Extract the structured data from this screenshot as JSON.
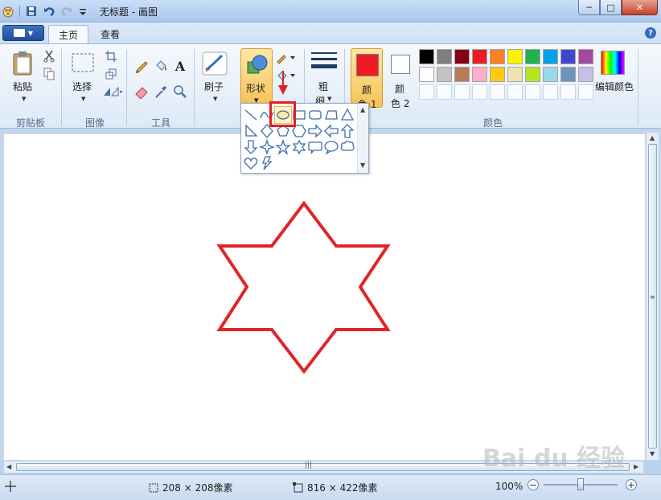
{
  "window": {
    "title": "无标题 - 画图",
    "controls": {
      "minimize": "─",
      "maximize": "□",
      "close": "✕"
    }
  },
  "tabs": {
    "home": "主页",
    "view": "查看",
    "help": "?"
  },
  "ribbon": {
    "clipboard": {
      "paste_label": "粘贴",
      "group": "剪贴板"
    },
    "image": {
      "select_label": "选择",
      "group": "图像"
    },
    "tools": {
      "text_glyph": "A",
      "group": "工具"
    },
    "brushes": {
      "label": "刷子"
    },
    "shapes": {
      "label": "形状"
    },
    "size": {
      "label_line1": "粗",
      "label_line2": "细"
    },
    "colors": {
      "color1_line1": "颜",
      "color1_line2": "色 1",
      "color2_line1": "颜",
      "color2_line2": "色 2",
      "edit_label": "编辑颜色",
      "group": "颜色",
      "color1_value": "#ed1c24",
      "color2_value": "#ffffff",
      "palette": [
        "#000000",
        "#7f7f7f",
        "#880015",
        "#ed1c24",
        "#ff7f27",
        "#fff200",
        "#22b14c",
        "#00a2e8",
        "#3f48cc",
        "#a349a4",
        "#ffffff",
        "#c3c3c3",
        "#b97a57",
        "#ffaec9",
        "#ffc90e",
        "#efe4b0",
        "#b5e61d",
        "#99d9ea",
        "#7092be",
        "#c8bfe7",
        "",
        "",
        "",
        "",
        "",
        "",
        "",
        "",
        "",
        ""
      ]
    }
  },
  "shapes_gallery": {
    "highlighted": "oval",
    "shapes": [
      "line",
      "curve",
      "oval",
      "rectangle",
      "rounded-rectangle",
      "polygon",
      "triangle",
      "right-triangle",
      "diamond",
      "pentagon",
      "hexagon",
      "right-arrow",
      "left-arrow",
      "up-arrow",
      "down-arrow",
      "four-point-star",
      "five-point-star",
      "six-point-star",
      "rounded-callout",
      "oval-callout",
      "cloud-callout",
      "heart",
      "lightning"
    ]
  },
  "canvas": {
    "drawing": "six-point-star",
    "stroke_color": "#e0242b"
  },
  "status": {
    "selection_size": "208 × 208像素",
    "canvas_size": "816 × 422像素",
    "zoom": "100%"
  },
  "watermark": "Bai du 经验"
}
